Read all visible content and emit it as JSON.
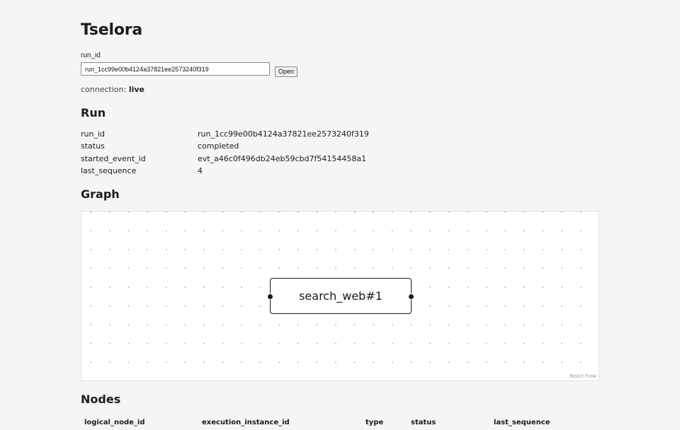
{
  "app": {
    "title": "Tselora"
  },
  "run_form": {
    "label": "run_id",
    "input_value": "run_1cc99e00b4124a37821ee2573240f319",
    "open_label": "Open"
  },
  "connection": {
    "label": "connection:",
    "status": "live"
  },
  "run_section": {
    "title": "Run",
    "fields": [
      {
        "key": "run_id",
        "value": "run_1cc99e00b4124a37821ee2573240f319"
      },
      {
        "key": "status",
        "value": "completed"
      },
      {
        "key": "started_event_id",
        "value": "evt_a46c0f496db24eb59cbd7f54154458a1"
      },
      {
        "key": "last_sequence",
        "value": "4"
      }
    ]
  },
  "graph_section": {
    "title": "Graph",
    "node_label": "search_web#1",
    "attribution": "React Flow"
  },
  "nodes_section": {
    "title": "Nodes",
    "columns": [
      "logical_node_id",
      "execution_instance_id",
      "type",
      "status",
      "last_sequence"
    ]
  }
}
